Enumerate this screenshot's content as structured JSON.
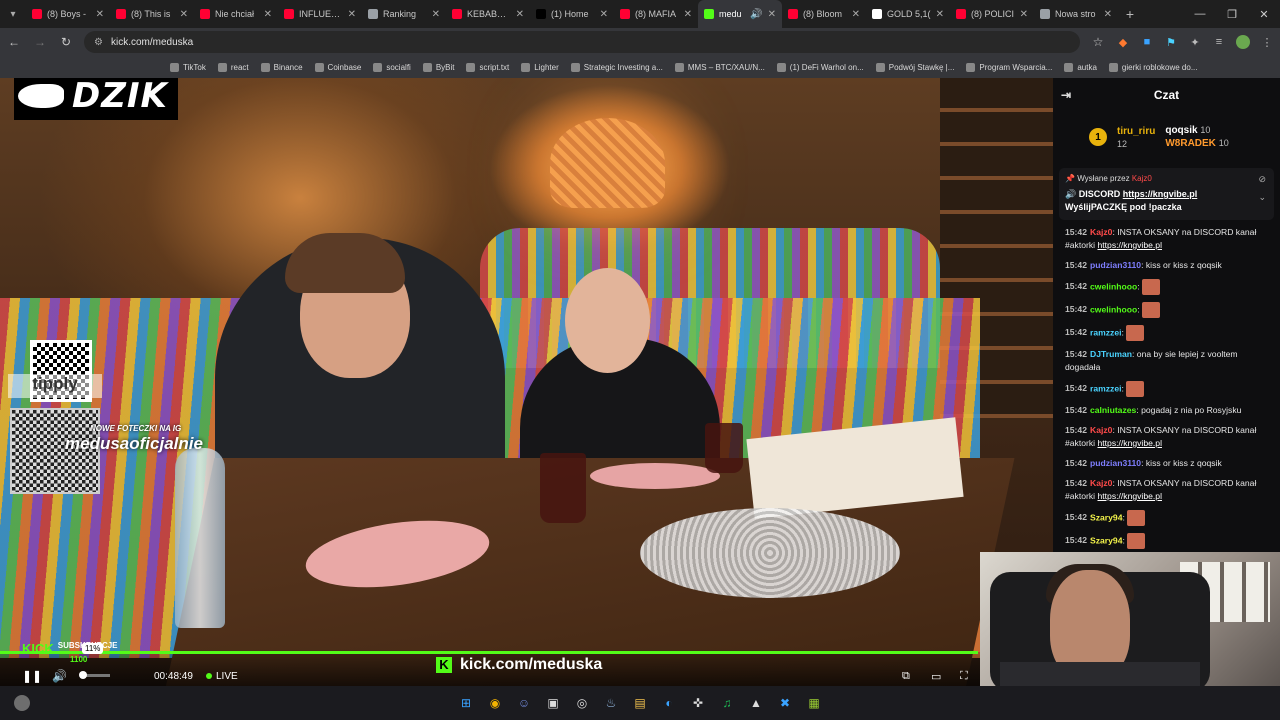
{
  "browser": {
    "tabs": [
      {
        "title": "(8) Boys -",
        "color": "#ff0033"
      },
      {
        "title": "(8) This is",
        "color": "#ff0033"
      },
      {
        "title": "Nie chciał",
        "color": "#ff0033"
      },
      {
        "title": "INFLUENC",
        "color": "#ff0033"
      },
      {
        "title": "Ranking",
        "color": "#9aa0a6"
      },
      {
        "title": "KEBABOW",
        "color": "#ff0033"
      },
      {
        "title": "(1) Home",
        "color": "#000000"
      },
      {
        "title": "(8) MAFIA",
        "color": "#ff0033"
      },
      {
        "title": "medu",
        "color": "#53fc18",
        "active": true
      },
      {
        "title": "(8) Bloom",
        "color": "#ff0033"
      },
      {
        "title": "GOLD 5,1(",
        "color": "#ffffff"
      },
      {
        "title": "(8) POLICI",
        "color": "#ff0033"
      },
      {
        "title": "Nowa stro",
        "color": "#9aa0a6"
      }
    ],
    "new_tab": "+",
    "url": "kick.com/meduska",
    "bookmarks": [
      "TikTok",
      "react",
      "Binance",
      "Coinbase",
      "socialfi",
      "ByBit",
      "script.txt",
      "Lighter",
      "Strategic Investing a...",
      "MMS – BTC/XAU/N...",
      "(1) DeFi Warhol on...",
      "Podwój Stawkę |...",
      "Program Wsparcia...",
      "autka",
      "gierki roblokowe do..."
    ]
  },
  "stream": {
    "logo_text": "DZIK",
    "tipply_text": "tipply",
    "ig_small": "NOWE FOTECZKI NA IG",
    "ig_handle": "medusaoficjalnie",
    "kick_url": "kick.com/meduska",
    "subs_label": "SUBSKRYPCJE",
    "subs_value": "1100",
    "subs_badge": "KICK",
    "volume_tooltip": "11%",
    "volume_level": 0.11,
    "time": "00:48:49",
    "live_label": "LIVE",
    "progress_color": "#53fc18"
  },
  "chat": {
    "title": "Czat",
    "leaderboard": {
      "rank": "1",
      "first": {
        "name": "tiru_riru",
        "count": "12"
      },
      "second": {
        "name": "qoqsik",
        "count": "10"
      },
      "third": {
        "name": "W8RADEK",
        "count": "10"
      }
    },
    "pinned": {
      "sent_by_label": "Wysłane przez",
      "sender": "Kajz0",
      "text_prefix": "DISCORD",
      "link": "https://kngvibe.pl",
      "text_suffix": "WyślijPACZKĘ pod !paczka"
    },
    "messages": [
      {
        "time": "15:42",
        "user": "Kajz0",
        "color": "#ff4a4a",
        "text": ": INSTA OKSANY na DISCORD kanał #aktorki ",
        "link": "https://kngvibe.pl"
      },
      {
        "time": "15:42",
        "user": "pudzian3110",
        "color": "#7f7fff",
        "text": ": kiss or kiss z qoqsik",
        "link": ""
      },
      {
        "time": "15:42",
        "user": "cwelinhooo",
        "color": "#53fc18",
        "text": ":",
        "link": "",
        "emote": true
      },
      {
        "time": "15:42",
        "user": "cwelinhooo",
        "color": "#53fc18",
        "text": ":",
        "link": "",
        "emote": true
      },
      {
        "time": "15:42",
        "user": "ramzzei",
        "color": "#4ad3ff",
        "text": ":",
        "link": "",
        "emote": true
      },
      {
        "time": "15:42",
        "user": "DJTruman",
        "color": "#4ad3ff",
        "text": ": ona by sie lepiej z vooltem dogadała",
        "link": ""
      },
      {
        "time": "15:42",
        "user": "ramzzei",
        "color": "#4ad3ff",
        "text": ":",
        "link": "",
        "emote": true
      },
      {
        "time": "15:42",
        "user": "calniutazes",
        "color": "#53fc18",
        "text": ": pogadaj z nia po Rosyjsku",
        "link": ""
      },
      {
        "time": "15:42",
        "user": "Kajz0",
        "color": "#ff4a4a",
        "text": ": INSTA OKSANY na DISCORD kanał #aktorki ",
        "link": "https://kngvibe.pl"
      },
      {
        "time": "15:42",
        "user": "pudzian3110",
        "color": "#7f7fff",
        "text": ": kiss or kiss z qoqsik",
        "link": ""
      },
      {
        "time": "15:42",
        "user": "Kajz0",
        "color": "#ff4a4a",
        "text": ": INSTA OKSANY na DISCORD kanał #aktorki ",
        "link": "https://kngvibe.pl"
      },
      {
        "time": "15:42",
        "user": "Szary94",
        "color": "#f2f24a",
        "text": ":",
        "link": "",
        "emote": true
      },
      {
        "time": "15:42",
        "user": "Szary94",
        "color": "#f2f24a",
        "text": ":",
        "link": "",
        "emote": true
      }
    ]
  },
  "taskbar": {
    "icons": [
      "windows-start-icon",
      "chrome-icon",
      "discord-icon",
      "app-icon",
      "app2-icon",
      "steam-icon",
      "folder-icon",
      "edge-icon",
      "tool-icon",
      "spotify-icon",
      "app3-icon",
      "app4-icon",
      "game-icon"
    ]
  }
}
